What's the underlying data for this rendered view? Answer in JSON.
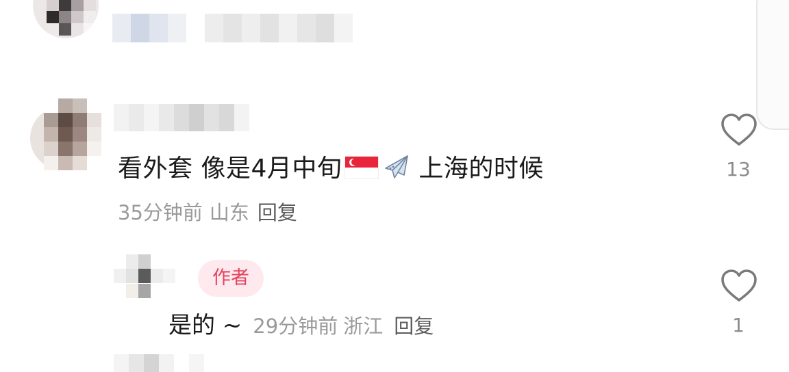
{
  "comment": {
    "text_before_flag": "看外套 像是4月中旬",
    "text_after_icons": "上海的时候",
    "time": "35分钟前",
    "location": "山东",
    "reply_label": "回复",
    "like_count": "13",
    "flag_icon": "singapore-flag-icon",
    "plane_icon": "airplane-icon"
  },
  "reply": {
    "author_badge": "作者",
    "text": "是的 ~",
    "time": "29分钟前",
    "location": "浙江",
    "reply_label": "回复",
    "like_count": "1"
  },
  "colors": {
    "badge_bg": "#fde9ee",
    "badge_text": "#e5435d",
    "meta_text": "#9a9a9a",
    "flag_red": "#e8253a"
  }
}
